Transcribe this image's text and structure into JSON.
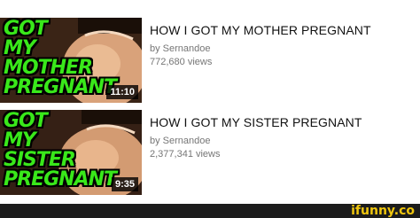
{
  "videos": [
    {
      "thumbnail_lines": [
        "GOT MY",
        "MOTHER",
        "PREGNANT"
      ],
      "duration": "11:10",
      "title": "HOW I GOT MY MOTHER PREGNANT",
      "channel": "by Sernandoe",
      "views": "772,680 views"
    },
    {
      "thumbnail_lines": [
        "GOT MY",
        "SISTER",
        "PREGNANT"
      ],
      "duration": "9:35",
      "title": "HOW I GOT MY SISTER PREGNANT",
      "channel": "by Sernandoe",
      "views": "2,377,341 views"
    }
  ],
  "watermark": "ifunny.co",
  "colors": {
    "thumbnail_text": "#39e81a",
    "watermark": "#f0c60e",
    "footer_bar": "#1c1c1c",
    "meta_text": "#767676"
  }
}
